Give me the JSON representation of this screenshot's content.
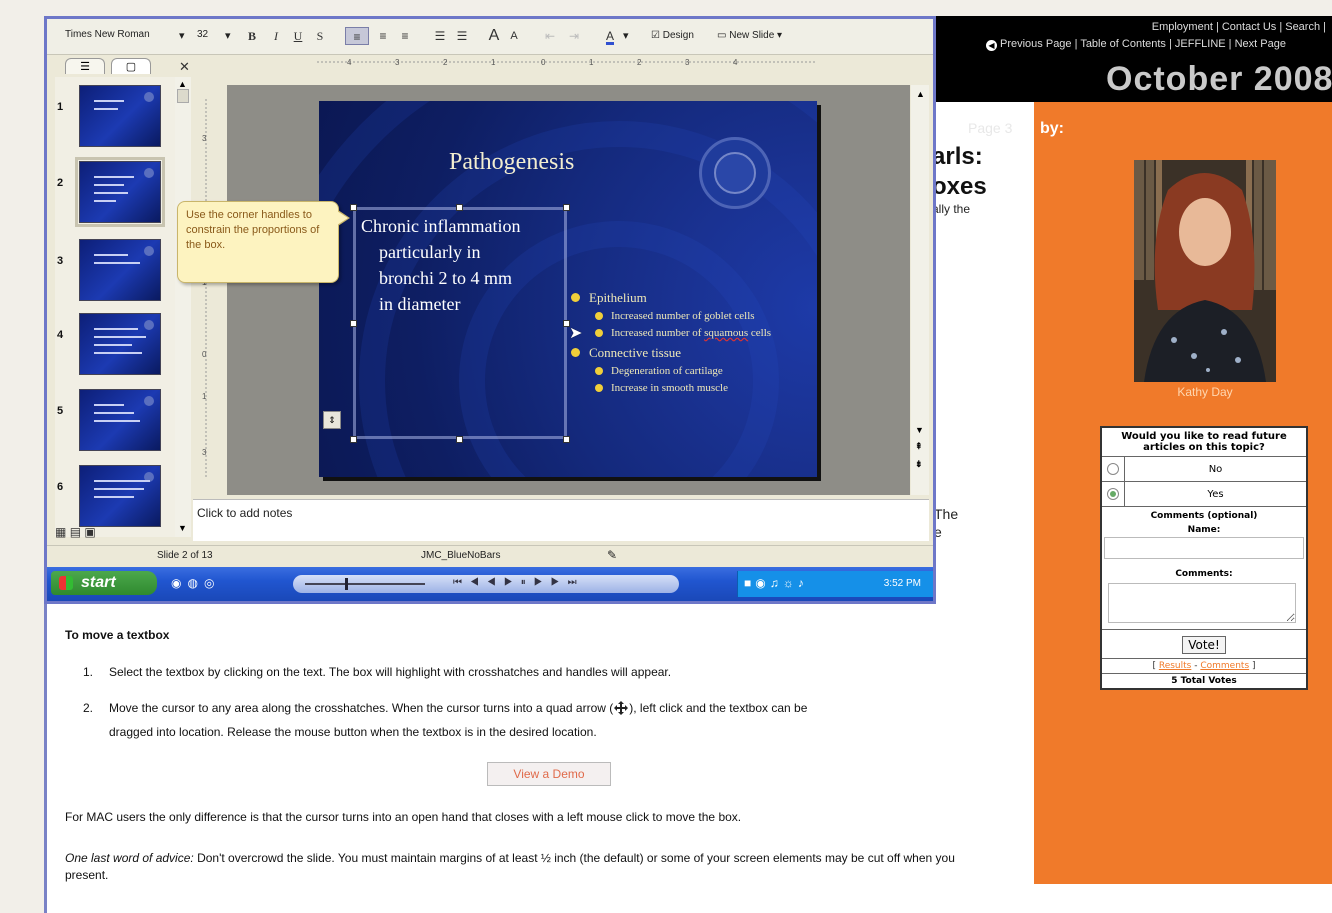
{
  "site": {
    "top_links": "Employment  |  Contact Us  |  Search  |",
    "nav_links": "Previous Page | Table of Contents | JEFFLINE  | Next Page",
    "issue_title": "October 2008",
    "page_ghost": "Page 3",
    "byline_label": "by:",
    "author_name": "Kathy Day",
    "article_heading_1": "arls:",
    "article_heading_2": "oxes",
    "article_text": "ally the",
    "fragment_the": "The",
    "fragment_e": "e"
  },
  "poll": {
    "question": "Would you like to read future articles on this topic?",
    "options": [
      {
        "label": "No",
        "selected": false
      },
      {
        "label": "Yes",
        "selected": true
      }
    ],
    "comments_heading": "Comments (optional)",
    "name_label": "Name:",
    "comments_label": "Comments:",
    "vote_label": "Vote!",
    "results_link": "Results",
    "comments_link": "Comments",
    "link_separator": " - ",
    "bracket_open": "[ ",
    "bracket_close": " ]",
    "total_votes": "5 Total Votes"
  },
  "ppt": {
    "font_name": "Times New Roman",
    "font_size": "32",
    "design_label": "Design",
    "new_slide_label": "New Slide",
    "slide_numbers": [
      "1",
      "2",
      "3",
      "4",
      "5",
      "6"
    ],
    "selected_slide": 2,
    "tooltip": "Use the corner handles to constrain the proportions of the box.",
    "slide_title": "Pathogenesis",
    "textbox_line1": "Chronic inflammation",
    "textbox_rest": [
      "particularly in",
      "bronchi 2 to 4 mm",
      "in diameter"
    ],
    "bullets": [
      {
        "text": "Epithelium",
        "subs": [
          "Increased number of goblet cells",
          "Increased number of squamous cells"
        ]
      },
      {
        "text": "Connective tissue",
        "subs": [
          "Degeneration of cartilage",
          "Increase in smooth muscle"
        ]
      }
    ],
    "notes_placeholder": "Click to add notes",
    "status_slide": "Slide 2 of 13",
    "status_design": "JMC_BlueNoBars",
    "start_label": "start",
    "clock": "3:52 PM"
  },
  "tutorial": {
    "heading": "To move a textbox",
    "step1_num": "1.",
    "step1": "Select the textbox by clicking on the text. The box will highlight with crosshatches and handles will appear.",
    "step2_num": "2.",
    "step2_a": "Move the cursor to any area along the crosshatches. When the cursor turns into a quad arrow (",
    "step2_b": "), left click and the textbox can be",
    "step2_c": "dragged into location. Release the mouse button when the textbox is in the desired location.",
    "demo_button": "View a Demo",
    "mac_note": "For MAC users the only difference is that the cursor turns into an open hand that closes with a left mouse click to move the box.",
    "advice_label": "One last word of advice:",
    "advice_text": " Don't overcrowd the slide. You must maintain margins of at least ½ inch (the default) or some of your screen elements may be cut off when you present."
  },
  "colors": {
    "sidebar_orange": "#f07a2a",
    "window_border": "#6e77c8",
    "slide_blue": "#14297c",
    "bullet_yellow": "#f0cf3a"
  }
}
